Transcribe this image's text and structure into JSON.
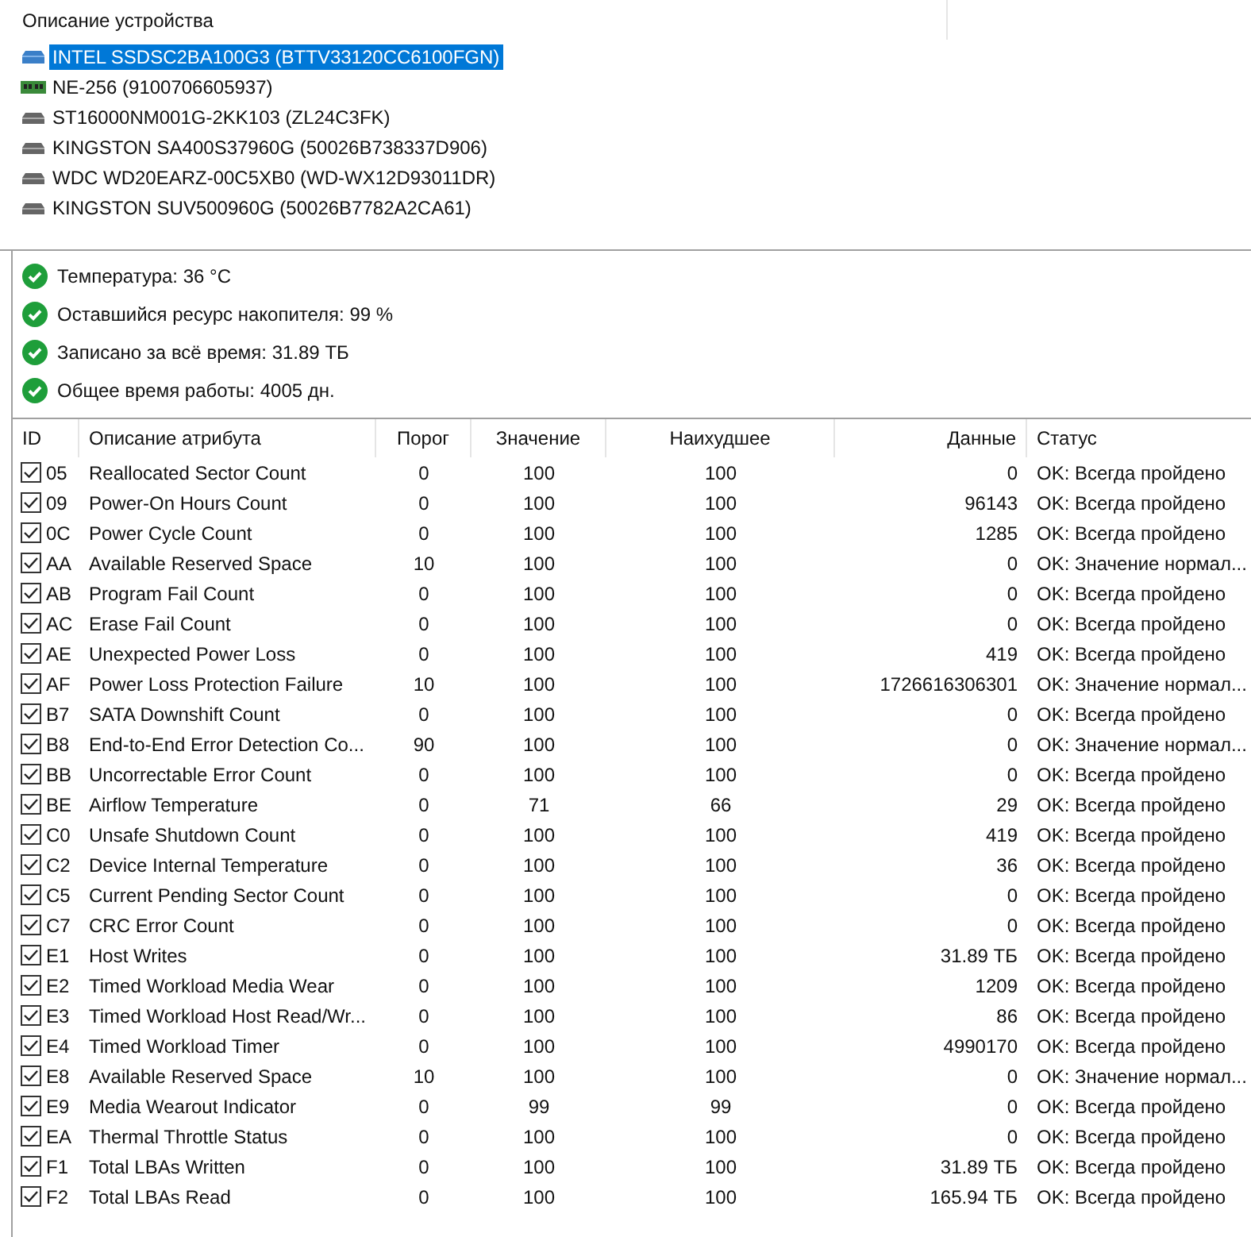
{
  "device_panel": {
    "header": "Описание устройства",
    "devices": [
      {
        "kind": "ssd",
        "label": "INTEL SSDSC2BA100G3 (BTTV33120CC6100FGN)",
        "selected": true
      },
      {
        "kind": "memory",
        "label": "NE-256 (9100706605937)",
        "selected": false
      },
      {
        "kind": "hdd",
        "label": "ST16000NM001G-2KK103 (ZL24C3FK)",
        "selected": false
      },
      {
        "kind": "hdd",
        "label": "KINGSTON SA400S37960G (50026B738337D906)",
        "selected": false
      },
      {
        "kind": "hdd",
        "label": "WDC WD20EARZ-00C5XB0 (WD-WX12D93011DR)",
        "selected": false
      },
      {
        "kind": "hdd",
        "label": "KINGSTON SUV500960G (50026B7782A2CA61)",
        "selected": false
      }
    ]
  },
  "summary": [
    {
      "text": "Температура: 36 °C"
    },
    {
      "text": "Оставшийся ресурс накопителя: 99 %"
    },
    {
      "text": "Записано за всё время: 31.89 ТБ"
    },
    {
      "text": "Общее время работы: 4005 дн."
    }
  ],
  "table": {
    "columns": [
      "ID",
      "Описание атрибута",
      "Порог",
      "Значение",
      "Наихудшее",
      "Данные",
      "Статус"
    ],
    "rows": [
      {
        "checked": true,
        "id": "05",
        "name": "Reallocated Sector Count",
        "threshold": "0",
        "value": "100",
        "worst": "100",
        "data": "0",
        "status": "OK: Всегда пройдено"
      },
      {
        "checked": true,
        "id": "09",
        "name": "Power-On Hours Count",
        "threshold": "0",
        "value": "100",
        "worst": "100",
        "data": "96143",
        "status": "OK: Всегда пройдено"
      },
      {
        "checked": true,
        "id": "0C",
        "name": "Power Cycle Count",
        "threshold": "0",
        "value": "100",
        "worst": "100",
        "data": "1285",
        "status": "OK: Всегда пройдено"
      },
      {
        "checked": true,
        "id": "AA",
        "name": "Available Reserved Space",
        "threshold": "10",
        "value": "100",
        "worst": "100",
        "data": "0",
        "status": "OK: Значение нормал..."
      },
      {
        "checked": true,
        "id": "AB",
        "name": "Program Fail Count",
        "threshold": "0",
        "value": "100",
        "worst": "100",
        "data": "0",
        "status": "OK: Всегда пройдено"
      },
      {
        "checked": true,
        "id": "AC",
        "name": "Erase Fail Count",
        "threshold": "0",
        "value": "100",
        "worst": "100",
        "data": "0",
        "status": "OK: Всегда пройдено"
      },
      {
        "checked": true,
        "id": "AE",
        "name": "Unexpected Power Loss",
        "threshold": "0",
        "value": "100",
        "worst": "100",
        "data": "419",
        "status": "OK: Всегда пройдено"
      },
      {
        "checked": true,
        "id": "AF",
        "name": "Power Loss Protection Failure",
        "threshold": "10",
        "value": "100",
        "worst": "100",
        "data": "1726616306301",
        "status": "OK: Значение нормал..."
      },
      {
        "checked": true,
        "id": "B7",
        "name": "SATA Downshift Count",
        "threshold": "0",
        "value": "100",
        "worst": "100",
        "data": "0",
        "status": "OK: Всегда пройдено"
      },
      {
        "checked": true,
        "id": "B8",
        "name": "End-to-End Error Detection Co...",
        "threshold": "90",
        "value": "100",
        "worst": "100",
        "data": "0",
        "status": "OK: Значение нормал..."
      },
      {
        "checked": true,
        "id": "BB",
        "name": "Uncorrectable Error Count",
        "threshold": "0",
        "value": "100",
        "worst": "100",
        "data": "0",
        "status": "OK: Всегда пройдено"
      },
      {
        "checked": true,
        "id": "BE",
        "name": "Airflow Temperature",
        "threshold": "0",
        "value": "71",
        "worst": "66",
        "data": "29",
        "status": "OK: Всегда пройдено"
      },
      {
        "checked": true,
        "id": "C0",
        "name": "Unsafe Shutdown Count",
        "threshold": "0",
        "value": "100",
        "worst": "100",
        "data": "419",
        "status": "OK: Всегда пройдено"
      },
      {
        "checked": true,
        "id": "C2",
        "name": "Device Internal Temperature",
        "threshold": "0",
        "value": "100",
        "worst": "100",
        "data": "36",
        "status": "OK: Всегда пройдено"
      },
      {
        "checked": true,
        "id": "C5",
        "name": "Current Pending Sector Count",
        "threshold": "0",
        "value": "100",
        "worst": "100",
        "data": "0",
        "status": "OK: Всегда пройдено"
      },
      {
        "checked": true,
        "id": "C7",
        "name": "CRC Error Count",
        "threshold": "0",
        "value": "100",
        "worst": "100",
        "data": "0",
        "status": "OK: Всегда пройдено"
      },
      {
        "checked": true,
        "id": "E1",
        "name": "Host Writes",
        "threshold": "0",
        "value": "100",
        "worst": "100",
        "data": "31.89 ТБ",
        "status": "OK: Всегда пройдено"
      },
      {
        "checked": true,
        "id": "E2",
        "name": "Timed Workload Media Wear",
        "threshold": "0",
        "value": "100",
        "worst": "100",
        "data": "1209",
        "status": "OK: Всегда пройдено"
      },
      {
        "checked": true,
        "id": "E3",
        "name": "Timed Workload Host Read/Wr...",
        "threshold": "0",
        "value": "100",
        "worst": "100",
        "data": "86",
        "status": "OK: Всегда пройдено"
      },
      {
        "checked": true,
        "id": "E4",
        "name": "Timed Workload Timer",
        "threshold": "0",
        "value": "100",
        "worst": "100",
        "data": "4990170",
        "status": "OK: Всегда пройдено"
      },
      {
        "checked": true,
        "id": "E8",
        "name": "Available Reserved Space",
        "threshold": "10",
        "value": "100",
        "worst": "100",
        "data": "0",
        "status": "OK: Значение нормал..."
      },
      {
        "checked": true,
        "id": "E9",
        "name": "Media Wearout Indicator",
        "threshold": "0",
        "value": "99",
        "worst": "99",
        "data": "0",
        "status": "OK: Всегда пройдено"
      },
      {
        "checked": true,
        "id": "EA",
        "name": "Thermal Throttle Status",
        "threshold": "0",
        "value": "100",
        "worst": "100",
        "data": "0",
        "status": "OK: Всегда пройдено"
      },
      {
        "checked": true,
        "id": "F1",
        "name": "Total LBAs Written",
        "threshold": "0",
        "value": "100",
        "worst": "100",
        "data": "31.89 ТБ",
        "status": "OK: Всегда пройдено"
      },
      {
        "checked": true,
        "id": "F2",
        "name": "Total LBAs Read",
        "threshold": "0",
        "value": "100",
        "worst": "100",
        "data": "165.94 ТБ",
        "status": "OK: Всегда пройдено"
      }
    ]
  }
}
